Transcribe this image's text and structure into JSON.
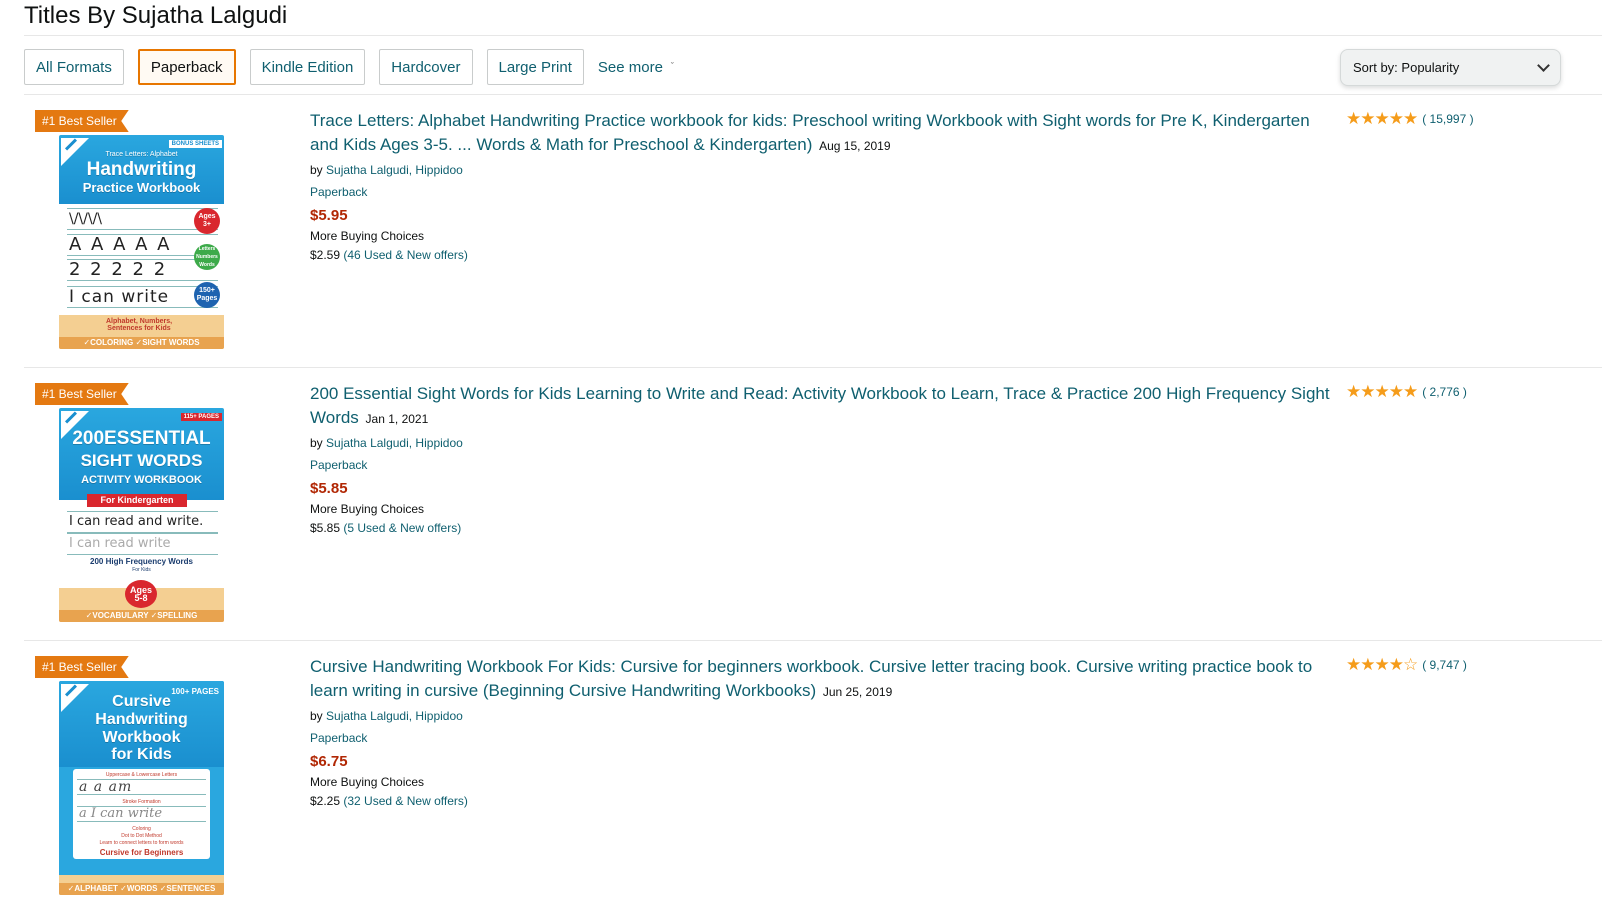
{
  "page": {
    "title": "Titles By Sujatha Lalgudi"
  },
  "filters": {
    "items": [
      {
        "label": "All Formats",
        "active": false
      },
      {
        "label": "Paperback",
        "active": true
      },
      {
        "label": "Kindle Edition",
        "active": false
      },
      {
        "label": "Hardcover",
        "active": false
      },
      {
        "label": "Large Print",
        "active": false
      }
    ],
    "see_more": "See more"
  },
  "sort": {
    "prefix": "Sort by:",
    "value": "Popularity"
  },
  "colors": {
    "link": "#0f5f6f",
    "price": "#b12704",
    "badge": "#e47911",
    "star": "#f59c1a",
    "active_border": "#e77600"
  },
  "results": [
    {
      "badge": "#1 Best Seller",
      "title": "Trace Letters: Alphabet Handwriting Practice workbook for kids: Preschool writing Workbook with Sight words for Pre K, Kindergarten and Kids Ages 3-5. ... Words & Math for Preschool & Kindergarten)",
      "date": "Aug 15, 2019",
      "by": "by",
      "authors": "Sujatha Lalgudi, Hippidoo",
      "format": "Paperback",
      "price": "$5.95",
      "more_buying": "More Buying Choices",
      "offer_price": "$2.59",
      "offer_link": "(46 Used & New offers)",
      "stars": 5,
      "stars_text": "★★★★★",
      "rating_count": "( 15,997 )",
      "cover": {
        "tag": "BONUS SHEETS",
        "sub": "Trace Letters: Alphabet",
        "main1": "Handwriting",
        "main2": "Practice Workbook",
        "line1": "\\/\\/\\/\\",
        "line2": "A A A A A",
        "line3": "2 2 2 2 2",
        "line4": "I can write",
        "badge_age": "Ages 3+",
        "badge_letters": "Letters Numbers Words",
        "badge_pages": "150+ Pages",
        "footer_label": "Alphabet, Numbers, Sentences for Kids",
        "strip": "✓COLORING   ✓SIGHT WORDS"
      }
    },
    {
      "badge": "#1 Best Seller",
      "title": "200 Essential Sight Words for Kids Learning to Write and Read: Activity Workbook to Learn, Trace & Practice 200 High Frequency Sight Words",
      "date": "Jan 1, 2021",
      "by": "by",
      "authors": "Sujatha Lalgudi, Hippidoo",
      "format": "Paperback",
      "price": "$5.85",
      "more_buying": "More Buying Choices",
      "offer_price": "$5.85",
      "offer_link": "(5 Used & New offers)",
      "stars": 5,
      "stars_text": "★★★★★",
      "rating_count": "( 2,776 )",
      "cover": {
        "tag": "115+ PAGES",
        "main1": "200ESSENTIAL",
        "main2": "SIGHT WORDS",
        "sub": "ACTIVITY WORKBOOK",
        "ribbon": "For Kindergarten",
        "line1": "I can read and write.",
        "line2": "I can read    write",
        "label": "200 High Frequency Words",
        "sublabel": "For Kids",
        "badge_age": "Ages 5-8",
        "strip": "✓VOCABULARY   ✓SPELLING"
      }
    },
    {
      "badge": "#1 Best Seller",
      "title": "Cursive Handwriting Workbook For Kids: Cursive for beginners workbook. Cursive letter tracing book. Cursive writing practice book to learn writing in cursive (Beginning Cursive Handwriting Workbooks)",
      "date": "Jun 25, 2019",
      "by": "by",
      "authors": "Sujatha Lalgudi, Hippidoo",
      "format": "Paperback",
      "price": "$6.75",
      "more_buying": "More Buying Choices",
      "offer_price": "$2.25",
      "offer_link": "(32 Used & New offers)",
      "stars": 4.5,
      "stars_text": "★★★★☆",
      "rating_count": "( 9,747 )",
      "cover": {
        "tag": "100+ PAGES",
        "main1": "Cursive",
        "main2": "Handwriting",
        "main3": "Workbook",
        "main4": "for Kids",
        "label1": "Uppercase & Lowercase Letters",
        "line1": "a   a   am",
        "label2": "Stroke Formation",
        "line2": "a   I can write",
        "label3": "Coloring",
        "label4": "Dot to Dot Method",
        "label5": "Learn to connect letters to form words",
        "label6": "Cursive for Beginners",
        "strip": "✓ALPHABET ✓WORDS ✓SENTENCES"
      }
    }
  ]
}
